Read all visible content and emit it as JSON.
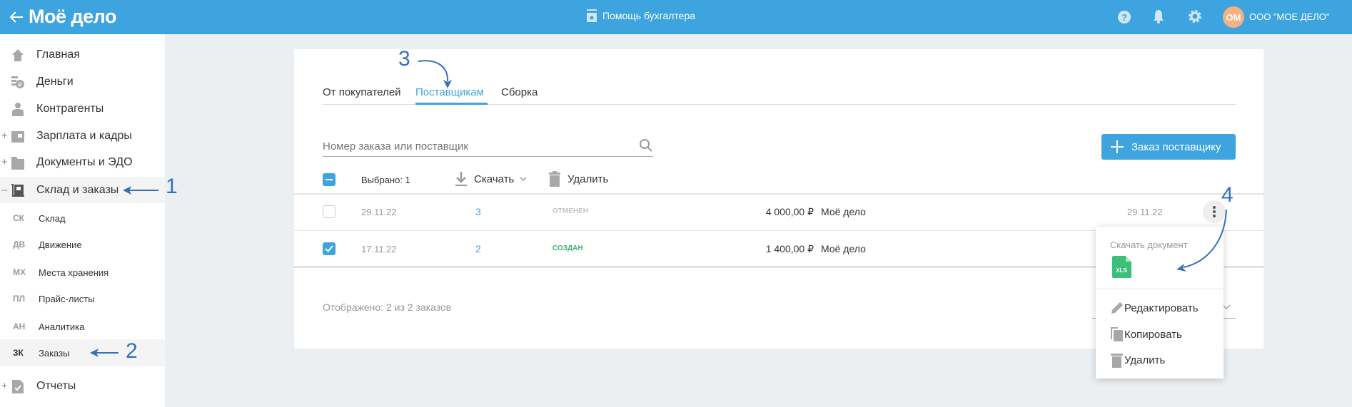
{
  "header": {
    "logo": "Моё дело",
    "helper": "Помощь бухгалтера",
    "avatar_initials": "ОМ",
    "company": "ООО \"МОЕ ДЕЛО\""
  },
  "sidebar": {
    "items": [
      {
        "label": "Главная"
      },
      {
        "label": "Деньги"
      },
      {
        "label": "Контрагенты"
      },
      {
        "label": "Зарплата и кадры",
        "expander": "+"
      },
      {
        "label": "Документы и ЭДО",
        "expander": "+"
      },
      {
        "label": "Склад и заказы",
        "expander": "–"
      }
    ],
    "sub_items": [
      {
        "abbr": "СК",
        "label": "Склад"
      },
      {
        "abbr": "ДВ",
        "label": "Движение"
      },
      {
        "abbr": "МХ",
        "label": "Места хранения"
      },
      {
        "abbr": "ПЛ",
        "label": "Прайс-листы"
      },
      {
        "abbr": "АН",
        "label": "Аналитика"
      },
      {
        "abbr": "ЗК",
        "label": "Заказы"
      }
    ],
    "reports": {
      "label": "Отчеты",
      "expander": "+"
    }
  },
  "tabs": [
    {
      "label": "От покупателей"
    },
    {
      "label": "Поставщикам",
      "active": true
    },
    {
      "label": "Сборка"
    }
  ],
  "search": {
    "placeholder": "Номер заказа или поставщик"
  },
  "add_button": {
    "label": "Заказ поставщику"
  },
  "toolbar": {
    "selected": "Выбрано: 1",
    "download": "Скачать",
    "delete": "Удалить"
  },
  "rows": [
    {
      "date": "29.11.22",
      "number": "3",
      "status": "ОТМЕНЕН",
      "amount": "4 000,00 ₽",
      "supplier": "Моё дело",
      "date2": "29.11.22",
      "checked": false
    },
    {
      "date": "17.11.22",
      "number": "2",
      "status": "СОЗДАН",
      "amount": "1 400,00 ₽",
      "supplier": "Моё дело",
      "checked": true
    }
  ],
  "footer": {
    "shown": "Отображено: 2 из 2 заказов"
  },
  "menu": {
    "download_title": "Скачать документ",
    "xls": "XLS",
    "edit": "Редактировать",
    "copy": "Копировать",
    "delete": "Удалить"
  },
  "annotations": {
    "a1": "1",
    "a2": "2",
    "a3": "3",
    "a4": "4"
  },
  "colors": {
    "brand": "#3ea4df",
    "annotation": "#3471b8",
    "status_created": "#3cb371",
    "status_cancelled": "#c4c4c4"
  }
}
